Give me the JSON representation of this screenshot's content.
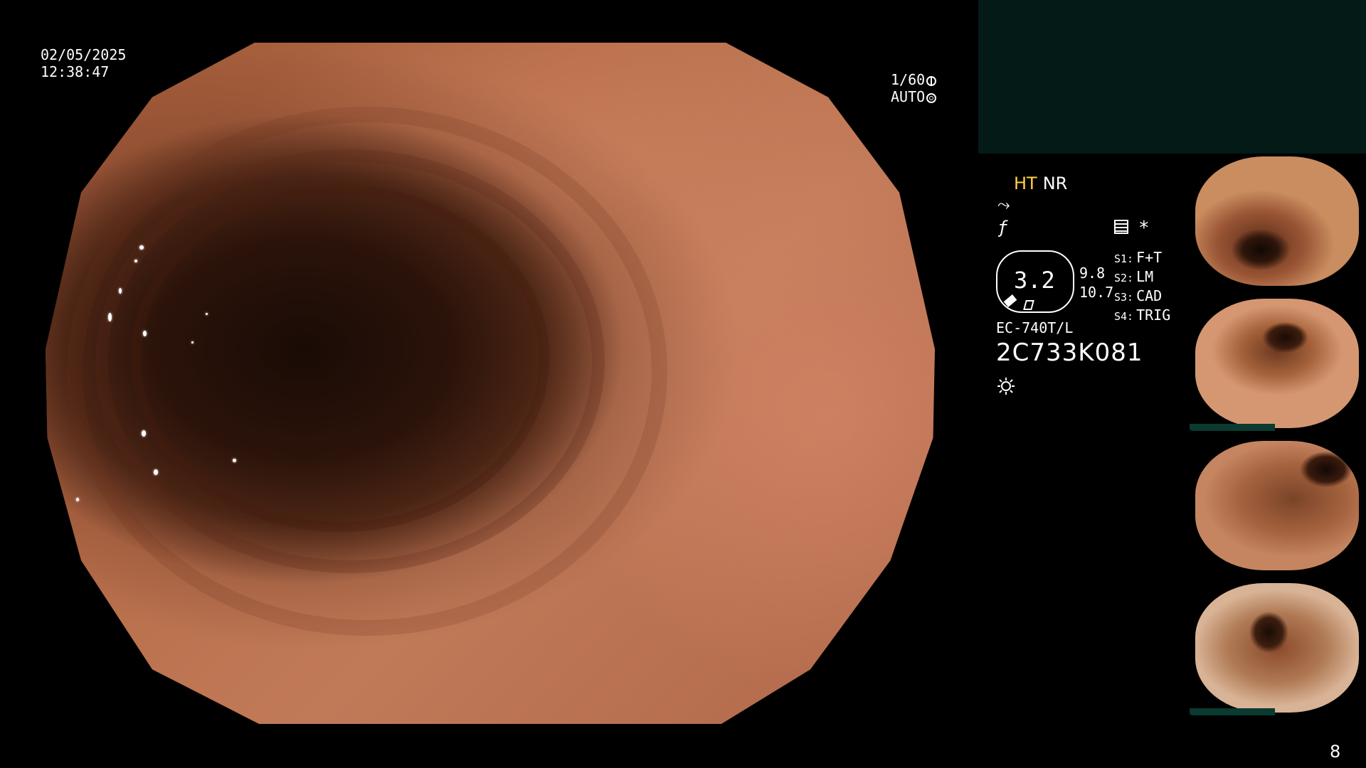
{
  "datetime": {
    "date": "02/05/2025",
    "time": "12:38:47"
  },
  "exposure": {
    "shutter": "1/60",
    "iris_mode": "AUTO"
  },
  "enhancement": {
    "ht_label": "HT",
    "nr_label": "NR"
  },
  "scope_indicator": {
    "value": "3.2",
    "reading_1": "9.8",
    "reading_2": "10.7"
  },
  "switch_settings": [
    {
      "key": "S1:",
      "value": "F+T"
    },
    {
      "key": "S2:",
      "value": "LM"
    },
    {
      "key": "S3:",
      "value": "CAD"
    },
    {
      "key": "S4:",
      "value": "TRIG"
    }
  ],
  "asterisk": "*",
  "endoscope": {
    "model": "EC-740T/L",
    "serial": "2C733K081"
  },
  "page_number": "8",
  "icons": {
    "shutter_icon": "aperture-icon",
    "iris_icon": "ring-icon",
    "curve_icon": "curve-icon",
    "fslash_icon": "f-slash-icon",
    "list_icon": "list-icon",
    "light_icon": "sun-icon"
  },
  "colors": {
    "ht_accent": "#ffd23f",
    "top_panel": "#031a16",
    "thumb_bar": "#0a3a30"
  },
  "thumbnails": [
    {
      "caption": "thumbnail 1"
    },
    {
      "caption": "thumbnail 2"
    },
    {
      "caption": "thumbnail 3"
    },
    {
      "caption": "thumbnail 4"
    }
  ]
}
